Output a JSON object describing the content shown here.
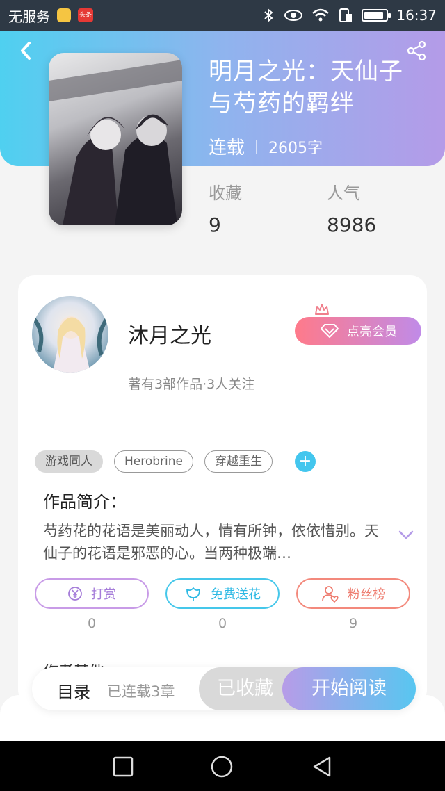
{
  "status_bar": {
    "carrier": "无服务",
    "badge_text": "头条",
    "time": "16:37",
    "battery_level": 0.9
  },
  "book": {
    "title": "明月之光：天仙子与芍药的羁绊",
    "status": "连载",
    "word_count": "2605字",
    "stats": [
      {
        "label": "收藏",
        "value": "9"
      },
      {
        "label": "人气",
        "value": "8986"
      }
    ]
  },
  "author": {
    "name": "沐月之光",
    "meta": "著有3部作品·3人关注",
    "vip_label": "点亮会员"
  },
  "tags": [
    "游戏同人",
    "Herobrine",
    "穿越重生"
  ],
  "intro": {
    "title": "作品简介：",
    "text": "芍药花的花语是美丽动人，情有所钟，依依惜别。天仙子的花语是邪恶的心。当两种极端…"
  },
  "actions": [
    {
      "label": "打赏",
      "count": "0",
      "icon": "yen-icon"
    },
    {
      "label": "免费送花",
      "count": "0",
      "icon": "flower-icon"
    },
    {
      "label": "粉丝榜",
      "count": "9",
      "icon": "fan-icon"
    }
  ],
  "peek_text": "作者其他",
  "bottom": {
    "toc_label": "目录",
    "chapters": "已连载3章",
    "collected_label": "已收藏",
    "read_label": "开始阅读"
  },
  "colors": {
    "header_start": "#4fd0f0",
    "header_end": "#b49be8",
    "accent_blue": "#43c6ee"
  }
}
